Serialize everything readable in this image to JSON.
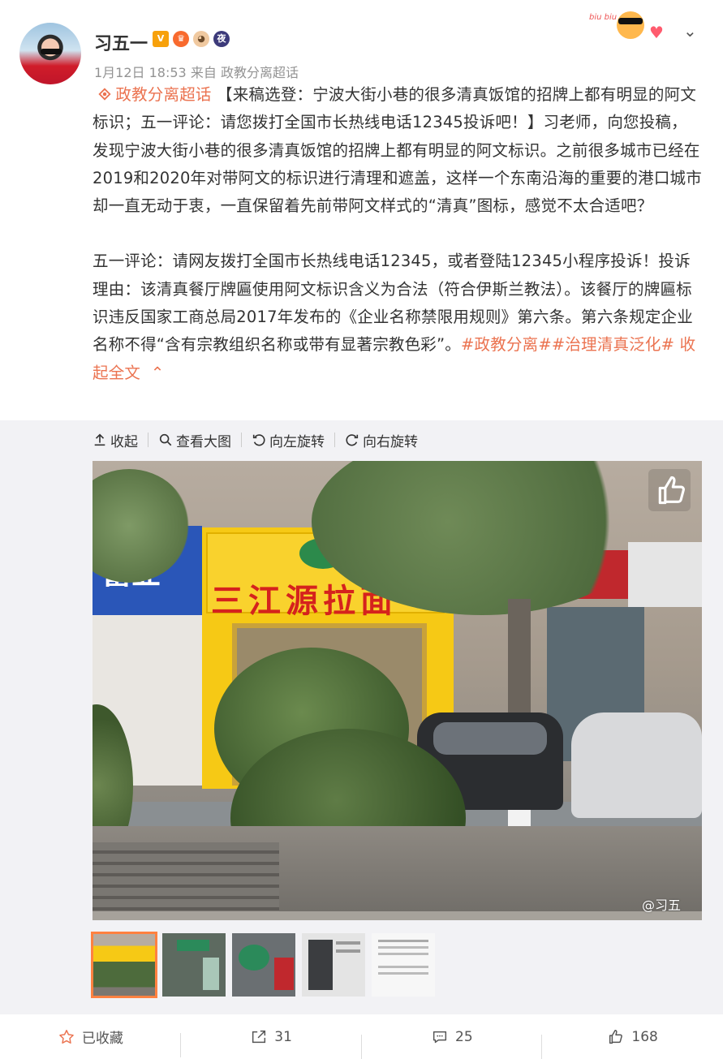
{
  "post": {
    "username": "习五一",
    "badges": [
      "V",
      "vip",
      "pet",
      "夜"
    ],
    "timestamp": "1月12日 18:53",
    "source_prefix": "来自",
    "source": "政教分离超话",
    "topic_link": "政教分离超话",
    "paragraph1": "【来稿选登：宁波大街小巷的很多清真饭馆的招牌上都有明显的阿文标识；五一评论：请您拨打全国市长热线电话12345投诉吧！】习老师，向您投稿，发现宁波大街小巷的很多清真饭馆的招牌上都有明显的阿文标识。之前很多城市已经在2019和2020年对带阿文的标识进行清理和遮盖，这样一个东南沿海的重要的港口城市却一直无动于衷，一直保留着先前带阿文样式的“清真”图标，感觉不太合适吧？",
    "paragraph2": "五一评论：请网友拨打全国市长热线电话12345，或者登陆12345小程序投诉！投诉理由：该清真餐厅牌匾使用阿文标识含义为合法（符合伊斯兰教法）。该餐厅的牌匾标识违反国家工商总局2017年发布的《企业名称禁限用规则》第六条。第六条规定企业名称不得“含有宗教组织名称或带有显著宗教色彩”。",
    "hashtags": "#政教分离##治理清真泛化#",
    "collapse": "收起全文",
    "collapse_arrow": "^"
  },
  "media_toolbar": {
    "collapse": "收起",
    "view_large": "查看大图",
    "rotate_left": "向左旋转",
    "rotate_right": "向右旋转"
  },
  "photo": {
    "shop_sign": "三江源拉面",
    "watermark": "@习五"
  },
  "actions": {
    "favorite": "已收藏",
    "repost": "31",
    "comment": "25",
    "like": "168"
  },
  "colors": {
    "accent": "#eb7350",
    "thumb_border": "#ff8140"
  }
}
